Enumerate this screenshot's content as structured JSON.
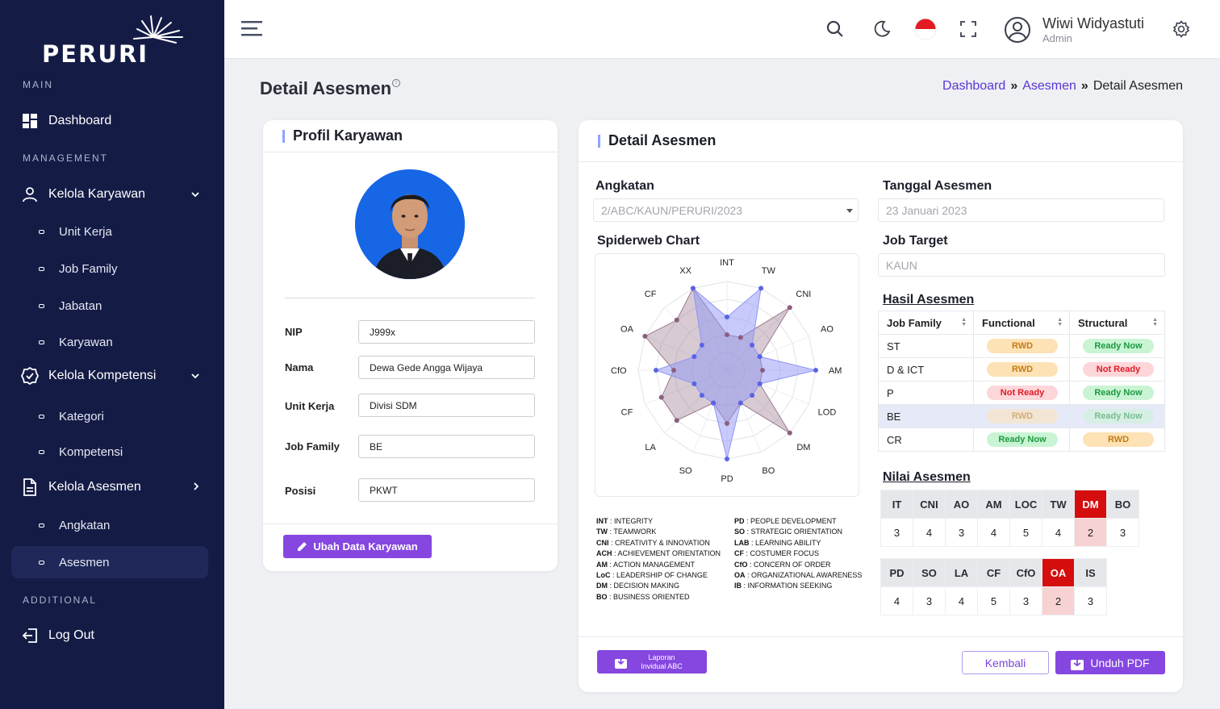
{
  "brand": "PERURI",
  "sidebar": {
    "sections": {
      "main": "MAIN",
      "management": "MANAGEMENT",
      "additional": "ADDITIONAL"
    },
    "dashboard": "Dashboard",
    "kelola_karyawan": "Kelola Karyawan",
    "karyawan_sub": [
      "Unit Kerja",
      "Job Family",
      "Jabatan",
      "Karyawan"
    ],
    "kelola_kompetensi": "Kelola Kompetensi",
    "kompetensi_sub": [
      "Kategori",
      "Kompetensi"
    ],
    "kelola_asesmen": "Kelola Asesmen",
    "asesmen_sub": [
      "Angkatan",
      "Asesmen"
    ],
    "logout": "Log Out"
  },
  "topbar": {
    "user_name": "Wiwi Widyastuti",
    "user_role": "Admin"
  },
  "page": {
    "title": "Detail Asesmen",
    "info_mark": "i"
  },
  "breadcrumb": {
    "home": "Dashboard",
    "parent": "Asesmen",
    "current": "Detail Asesmen",
    "sep": "»"
  },
  "profile": {
    "title": "Profil Karyawan",
    "fields": [
      {
        "label": "NIP",
        "value": "J999x"
      },
      {
        "label": "Nama",
        "value": "Dewa Gede Angga Wijaya"
      },
      {
        "label": "Unit Kerja",
        "value": "Divisi SDM"
      },
      {
        "label": "Job Family",
        "value": "BE"
      },
      {
        "label": "Posisi",
        "value": "PKWT"
      }
    ],
    "edit_button": "Ubah Data Karyawan"
  },
  "detail": {
    "title": "Detail Asesmen",
    "angkatan_label": "Angkatan",
    "angkatan_value": "2/ABC/KAUN/PERURI/2023",
    "tanggal_label": "Tanggal Asesmen",
    "tanggal_value": "23 Januari 2023",
    "job_target_label": "Job Target",
    "job_target_value": "KAUN",
    "chart_label": "Spiderweb Chart",
    "hasil_label": "Hasil Asesmen",
    "hasil_headers": [
      "Job Family",
      "Functional",
      "Structural"
    ],
    "hasil_rows": [
      {
        "family": "ST",
        "functional": "RWD",
        "structural": "Ready Now"
      },
      {
        "family": "D & ICT",
        "functional": "RWD",
        "structural": "Not Ready"
      },
      {
        "family": "P",
        "functional": "Not Ready",
        "structural": "Ready Now"
      },
      {
        "family": "BE",
        "functional": "RWD",
        "structural": "Ready Now"
      },
      {
        "family": "CR",
        "functional": "Ready Now",
        "structural": "RWD"
      }
    ],
    "nilai_label": "Nilai Asesmen",
    "nilai_row1": {
      "codes": [
        "IT",
        "CNI",
        "AO",
        "AM",
        "LOC",
        "TW",
        "DM",
        "BO"
      ],
      "values": [
        "3",
        "4",
        "3",
        "4",
        "5",
        "4",
        "2",
        "3"
      ]
    },
    "nilai_row2": {
      "codes": [
        "PD",
        "SO",
        "LA",
        "CF",
        "CfO",
        "OA",
        "IS"
      ],
      "values": [
        "4",
        "3",
        "4",
        "5",
        "3",
        "2",
        "3"
      ]
    },
    "legend_left": [
      [
        "INT",
        "INTEGRITY"
      ],
      [
        "TW",
        "TEAMWORK"
      ],
      [
        "CNI",
        "CREATIVITY & INNOVATION"
      ],
      [
        "ACH",
        "ACHIEVEMENT ORIENTATION"
      ],
      [
        "AM",
        "ACTION MANAGEMENT"
      ],
      [
        "LoC",
        "LEADERSHIP OF CHANGE"
      ],
      [
        "DM",
        "DECISION MAKING"
      ],
      [
        "BO",
        "BUSINESS ORIENTED"
      ]
    ],
    "legend_right": [
      [
        "PD",
        "PEOPLE DEVELOPMENT"
      ],
      [
        "SO",
        "STRATEGIC ORIENTATION"
      ],
      [
        "LAB",
        "LEARNING ABILITY"
      ],
      [
        "CF",
        "COSTUMER FOCUS"
      ],
      [
        "CfO",
        "CONCERN OF ORDER"
      ],
      [
        "OA",
        "ORGANIZATIONAL AWARENESS"
      ],
      [
        "IB",
        "INFORMATION SEEKING"
      ]
    ],
    "report_button_line1": "Laporan",
    "report_button_line2": "Invidual ABC",
    "back_button": "Kembali",
    "pdf_button": "Unduh PDF"
  },
  "chart_data": {
    "type": "radar",
    "axes": [
      "INT",
      "TW",
      "CNI",
      "AO",
      "AM",
      "LOD",
      "DM",
      "BO",
      "PD",
      "SO",
      "LA",
      "CF",
      "CfO",
      "OA",
      "CF",
      "XX"
    ],
    "rlim": [
      0,
      5
    ],
    "series": [
      {
        "values": [
          3,
          5,
          2,
          2,
          5,
          2,
          2,
          2,
          5,
          2,
          2,
          2,
          4,
          2,
          2,
          5
        ]
      },
      {
        "values": [
          2,
          2,
          5,
          2,
          2,
          2,
          5,
          2,
          3,
          2,
          4,
          4,
          3,
          5,
          4,
          5
        ]
      }
    ],
    "colors": {
      "series_a": "#8f95f5",
      "series_b": "#9b7a90"
    }
  },
  "colors": {
    "sidebar": "#141c46",
    "accent": "#8547e0",
    "link": "#5b35d6",
    "bad": "#d50d0d"
  }
}
